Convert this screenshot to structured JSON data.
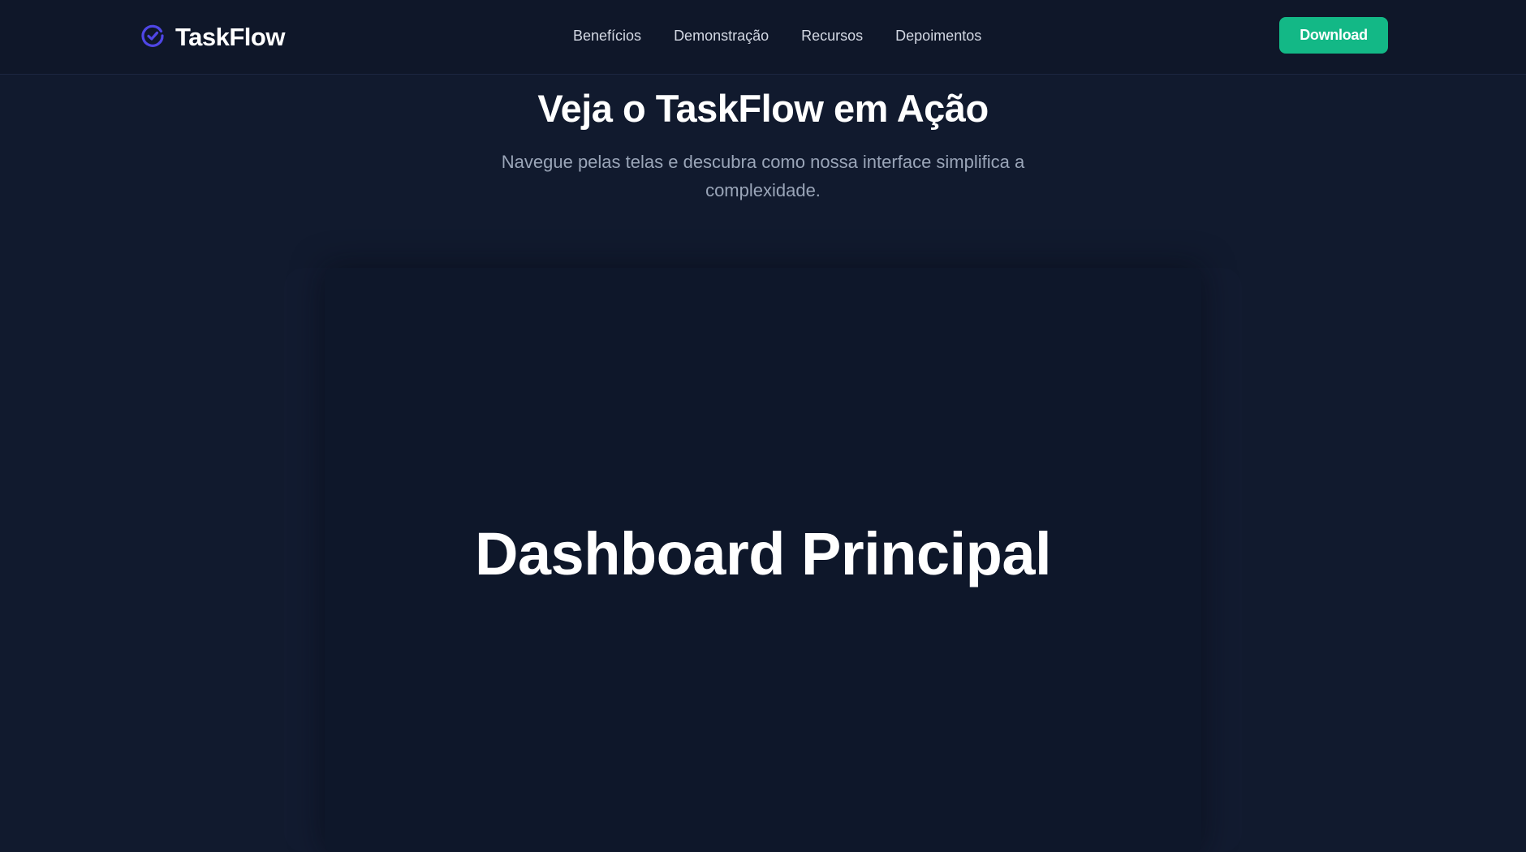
{
  "brand": {
    "name": "TaskFlow",
    "logo_icon": "check-circle-icon",
    "accent_color": "#4f46e5"
  },
  "nav": {
    "links": [
      "Benefícios",
      "Demonstração",
      "Recursos",
      "Depoimentos"
    ],
    "download_label": "Download",
    "download_color": "#13b886"
  },
  "demo": {
    "title": "Veja o TaskFlow em Ação",
    "subtitle": "Navegue pelas telas e descubra como nossa interface simplifica a complexidade.",
    "screen_title": "Dashboard Principal"
  }
}
